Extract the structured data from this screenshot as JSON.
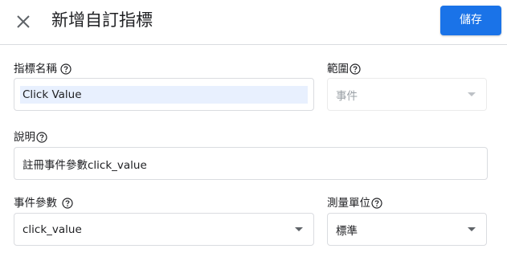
{
  "header": {
    "title": "新增自訂指標",
    "save_label": "儲存"
  },
  "form": {
    "name_label": "指標名稱",
    "name_value": "Click Value",
    "scope_label": "範圍",
    "scope_value": "事件",
    "description_label": "說明",
    "description_value": "註冊事件參數click_value",
    "event_param_label": "事件參數",
    "event_param_value": "click_value",
    "unit_label": "測量單位",
    "unit_value": "標準"
  },
  "icons": {
    "close": "close-icon",
    "help": "help-circle-icon",
    "dropdown": "chevron-down-icon"
  },
  "colors": {
    "primary": "#1a73e8",
    "border": "#dadce0",
    "selection": "#e8f0fe"
  }
}
